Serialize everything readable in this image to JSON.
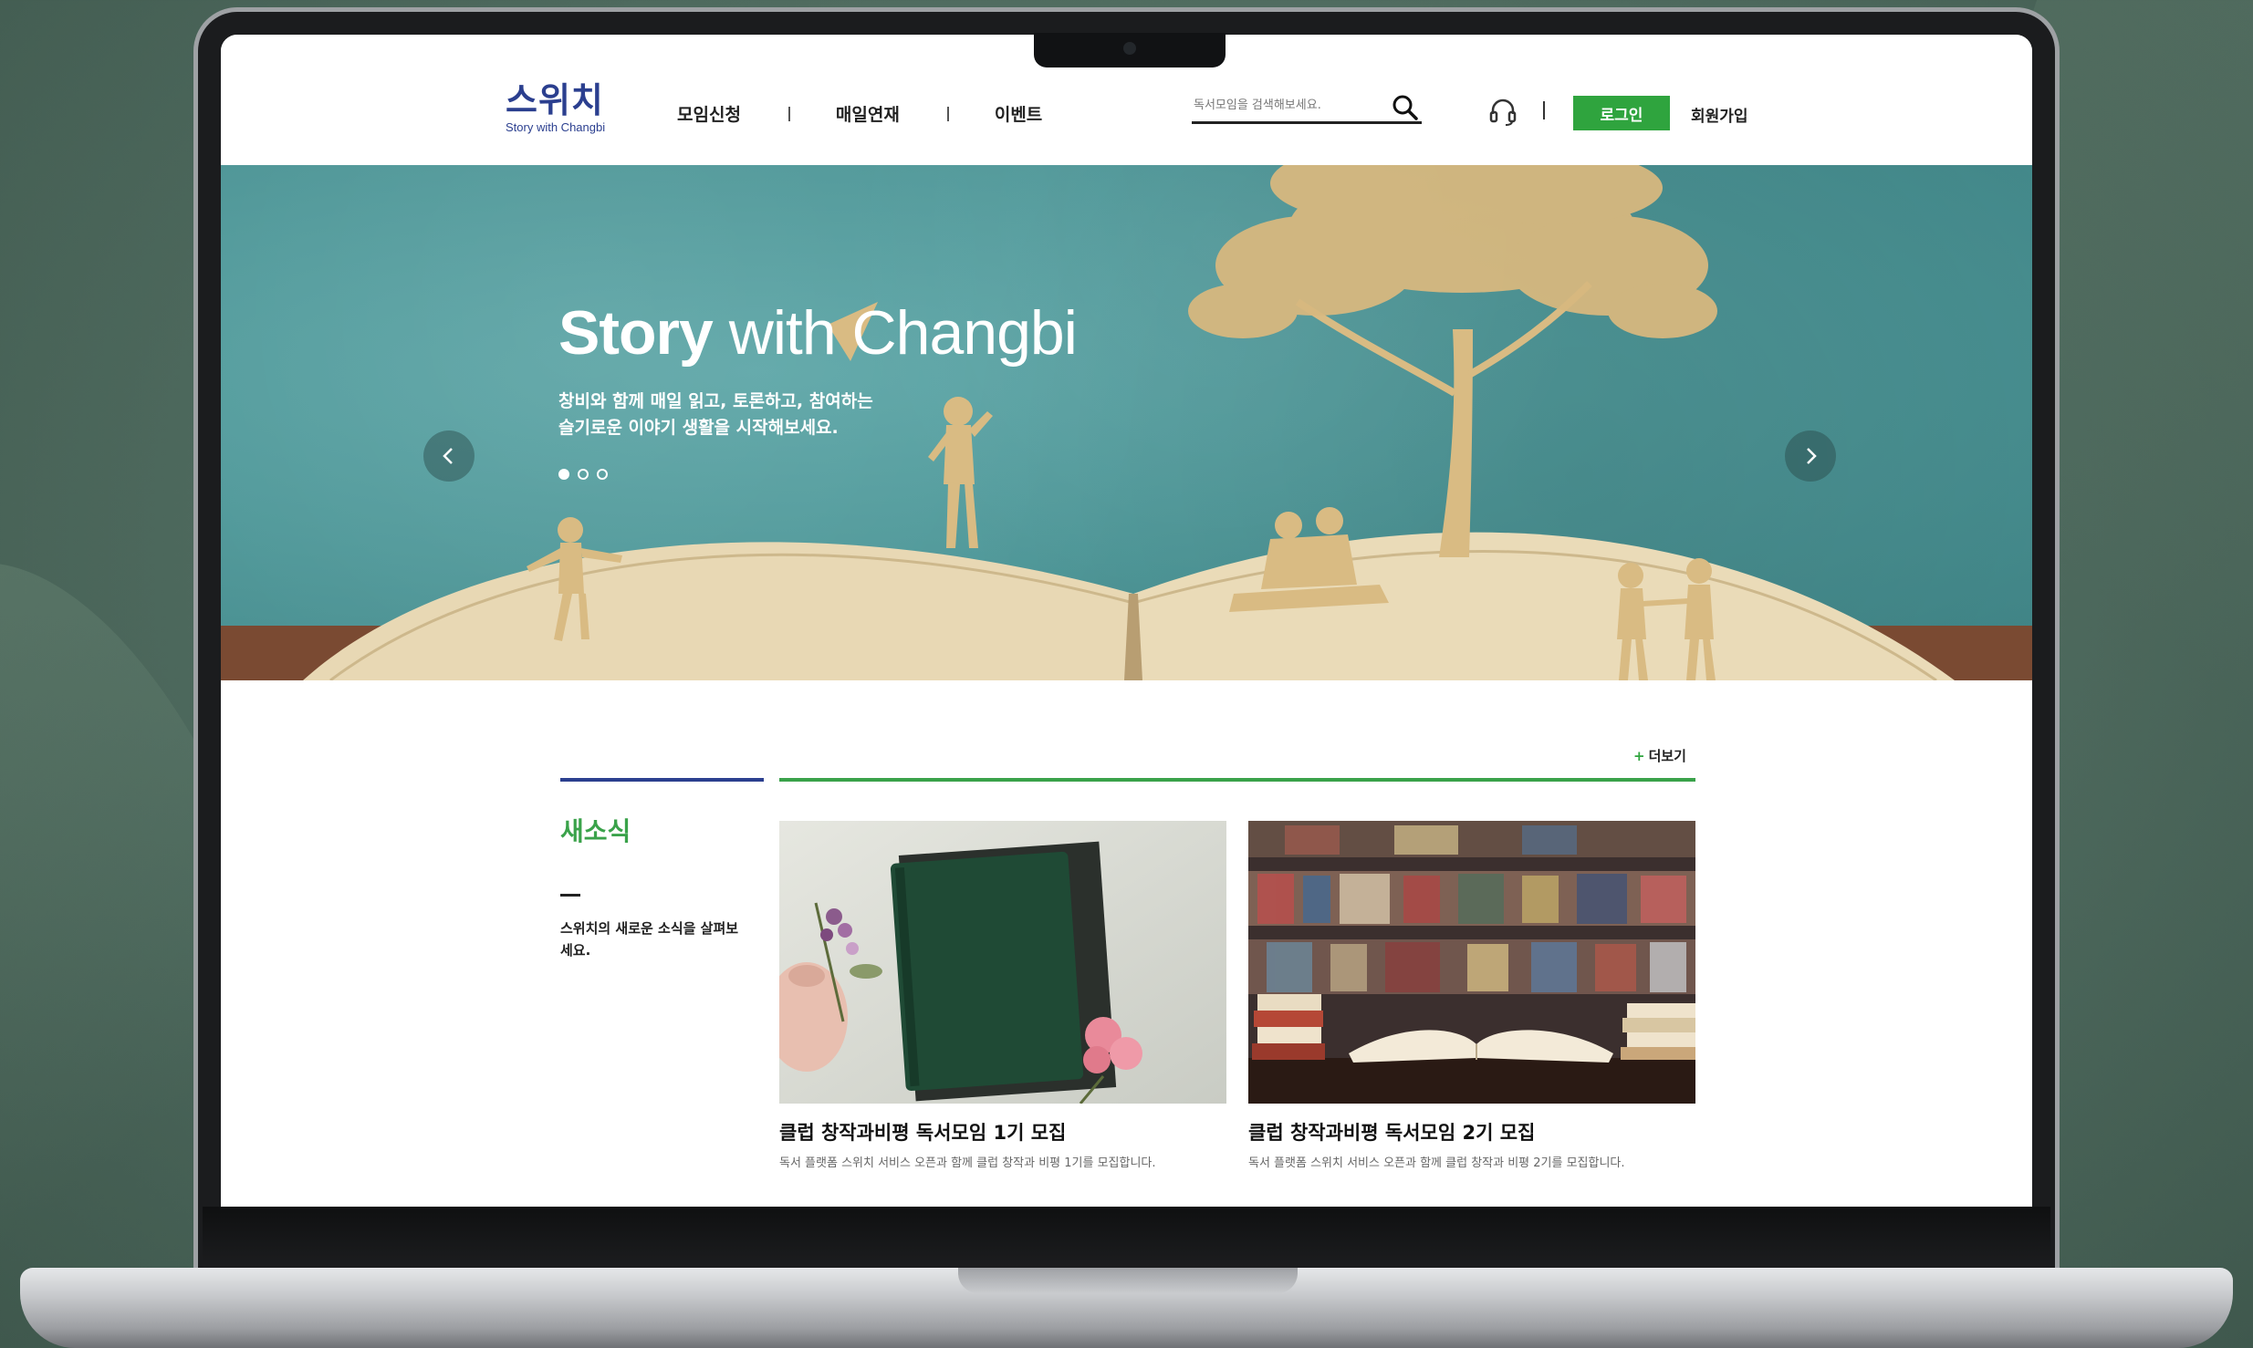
{
  "header": {
    "logo_mark": "스위치",
    "logo_sub": "Story with Changbi",
    "nav": [
      "모임신청",
      "매일연재",
      "이벤트"
    ],
    "search_placeholder": "독서모임을 검색해보세요.",
    "login_label": "로그인",
    "signup_label": "회원가입"
  },
  "hero": {
    "title_bold": "Story",
    "title_light": " with Changbi",
    "desc_line1": "창비와 함께 매일 읽고, 토론하고, 참여하는",
    "desc_line2": "슬기로운 이야기 생활을 시작해보세요.",
    "slide_count": 3,
    "active_slide": 1
  },
  "news": {
    "more_label": "더보기",
    "heading": "새소식",
    "desc": "스위치의 새로운 소식을 살펴보세요.",
    "cards": [
      {
        "title": "클럽 창작과비평 독서모임 1기 모집",
        "desc": "독서 플랫폼 스위치 서비스 오픈과 함께 클럽 창작과 비평 1기를 모집합니다."
      },
      {
        "title": "클럽 창작과비평 독서모임 2기 모집",
        "desc": "독서 플랫폼 스위치 서비스 오픈과 함께 클럽 창작과 비평 2기를 모집합니다."
      }
    ]
  },
  "colors": {
    "brand_blue": "#2b3f8f",
    "brand_green": "#2fa43e",
    "hero_teal": "#4f9899"
  }
}
